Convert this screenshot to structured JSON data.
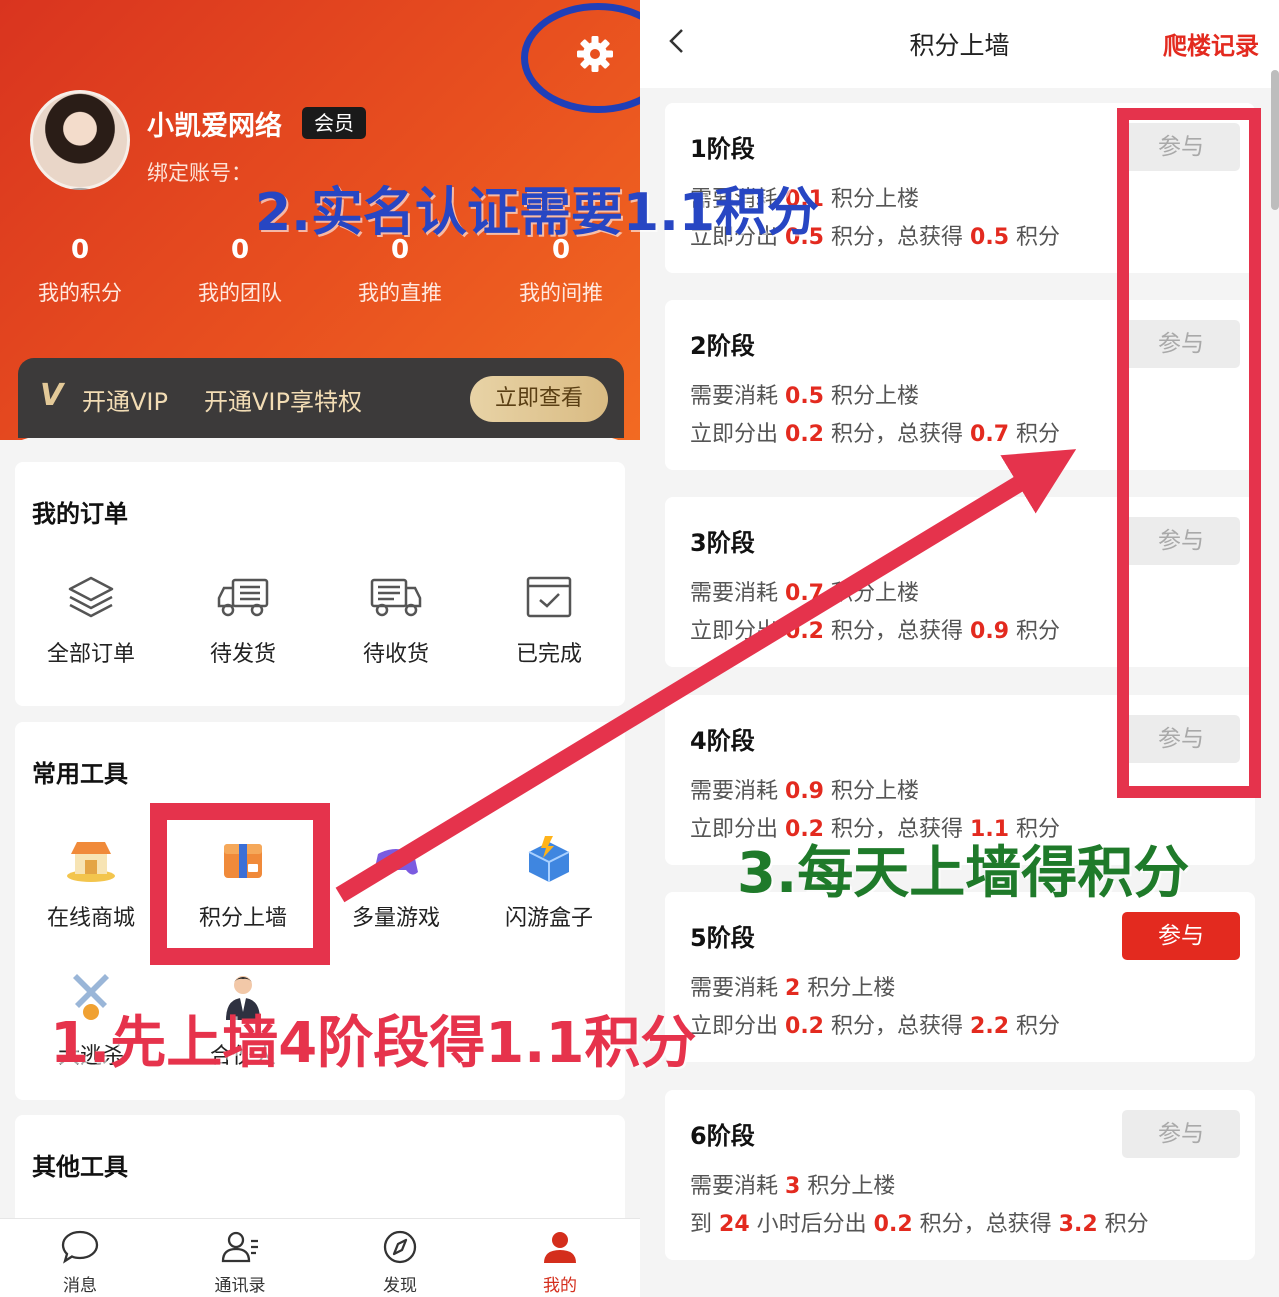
{
  "profile": {
    "name": "小凯爱网络",
    "badge": "会员",
    "bind_label": "绑定账号："
  },
  "stats": [
    {
      "value": "0",
      "label": "我的积分"
    },
    {
      "value": "0",
      "label": "我的团队"
    },
    {
      "value": "0",
      "label": "我的直推"
    },
    {
      "value": "0",
      "label": "我的间推"
    }
  ],
  "vip": {
    "logo": "V",
    "title": "开通VIP",
    "desc": "开通VIP享特权",
    "button": "立即查看"
  },
  "orders": {
    "title": "我的订单",
    "items": [
      {
        "label": "全部订单",
        "icon": "layers-icon"
      },
      {
        "label": "待发货",
        "icon": "truck-icon"
      },
      {
        "label": "待收货",
        "icon": "delivery-truck-icon"
      },
      {
        "label": "已完成",
        "icon": "check-calendar-icon"
      }
    ]
  },
  "tools": {
    "title": "常用工具",
    "items": [
      {
        "label": "在线商城",
        "icon": "shop-icon"
      },
      {
        "label": "积分上墙",
        "icon": "box-icon"
      },
      {
        "label": "多量游戏",
        "icon": "gamepad-icon"
      },
      {
        "label": "闪游盒子",
        "icon": "game-box-icon"
      },
      {
        "label": "大逃杀",
        "icon": "crossed-swords-icon"
      },
      {
        "label": "合伙人",
        "icon": "businessman-icon"
      }
    ]
  },
  "other_tools": {
    "title": "其他工具"
  },
  "tabbar": [
    {
      "label": "消息",
      "icon": "chat-bubble-icon"
    },
    {
      "label": "通讯录",
      "icon": "contacts-icon"
    },
    {
      "label": "发现",
      "icon": "compass-icon"
    },
    {
      "label": "我的",
      "icon": "user-icon"
    }
  ],
  "wall": {
    "title": "积分上墙",
    "record": "爬楼记录",
    "stages": [
      {
        "title": "1阶段",
        "consume": "0.1",
        "split_prefix": "立即分出",
        "split": "0.5",
        "total": "0.5",
        "join": "参与",
        "active": false
      },
      {
        "title": "2阶段",
        "consume": "0.5",
        "split_prefix": "立即分出",
        "split": "0.2",
        "total": "0.7",
        "join": "参与",
        "active": false
      },
      {
        "title": "3阶段",
        "consume": "0.7",
        "split_prefix": "立即分出",
        "split": "0.2",
        "total": "0.9",
        "join": "参与",
        "active": false
      },
      {
        "title": "4阶段",
        "consume": "0.9",
        "split_prefix": "立即分出",
        "split": "0.2",
        "total": "1.1",
        "join": "参与",
        "active": false
      },
      {
        "title": "5阶段",
        "consume": "2",
        "split_prefix": "立即分出",
        "split": "0.2",
        "total": "2.2",
        "join": "参与",
        "active": true
      },
      {
        "title": "6阶段",
        "consume": "3",
        "split_prefix": "到",
        "hours": "24",
        "hours_suffix": "小时后分出",
        "split": "0.2",
        "total": "3.2",
        "join": "参与",
        "active": false
      }
    ],
    "text": {
      "consume_prefix": "需要消耗",
      "consume_suffix": "积分上楼",
      "split_suffix": "积分，",
      "total_prefix": "总获得",
      "total_suffix": "积分"
    }
  },
  "annotations": {
    "step1": "1.先上墙4阶段得1.1积分",
    "step2": "2.实名认证需要1.1积分",
    "step3": "3.每天上墙得积分"
  },
  "colors": {
    "brand_red": "#e32a1f",
    "annotation_red": "#e5334c",
    "annotation_blue": "#2746c3",
    "annotation_green": "#1f7a2a"
  }
}
